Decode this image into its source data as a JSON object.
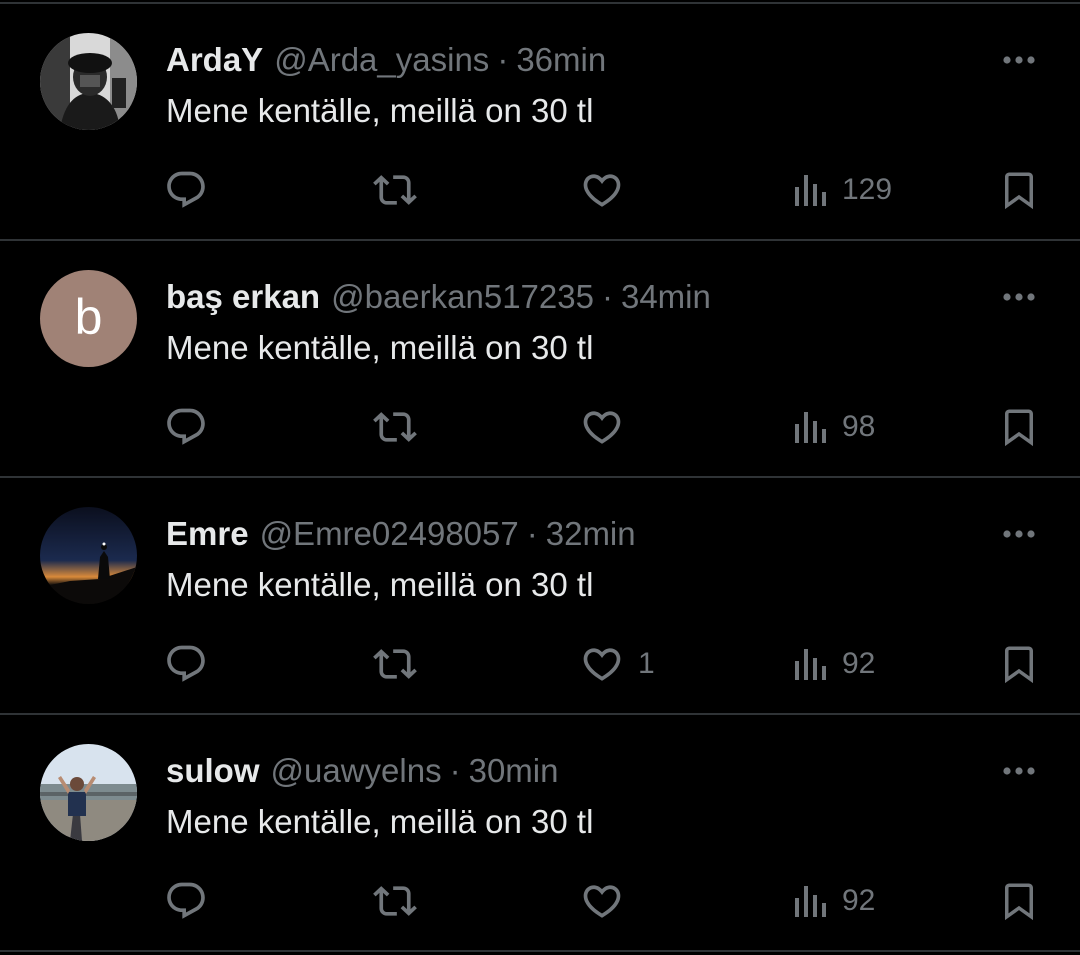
{
  "colors": {
    "background": "#000000",
    "primary_text": "#e7e9ea",
    "secondary_text": "#71767b",
    "separator": "#2f3336"
  },
  "tweets": [
    {
      "name": "ArdaY",
      "handle": "@Arda_yasins",
      "separator": "·",
      "time": "36min",
      "text": "Mene kentälle, meillä on 30 tl",
      "likes": "",
      "views": "129",
      "avatar": "photo-hooded-person"
    },
    {
      "name": "baş erkan",
      "handle": "@baerkan517235",
      "separator": "·",
      "time": "34min",
      "text": "Mene kentälle, meillä on 30 tl",
      "likes": "",
      "views": "98",
      "avatar_letter": "b",
      "avatar_color": "#a08276"
    },
    {
      "name": "Emre",
      "handle": "@Emre02498057",
      "separator": "·",
      "time": "32min",
      "text": "Mene kentälle, meillä on 30 tl",
      "likes": "1",
      "views": "92",
      "avatar": "photo-night-silhouette"
    },
    {
      "name": "sulow",
      "handle": "@uawyelns",
      "separator": "·",
      "time": "30min",
      "text": "Mene kentälle, meillä on 30 tl",
      "likes": "",
      "views": "92",
      "avatar": "photo-person-outdoors"
    }
  ],
  "icons": {
    "more": "more-dots-icon",
    "reply": "reply-bubble-icon",
    "retweet": "retweet-arrows-icon",
    "like": "heart-icon",
    "views": "views-bars-icon",
    "bookmark": "bookmark-icon"
  }
}
